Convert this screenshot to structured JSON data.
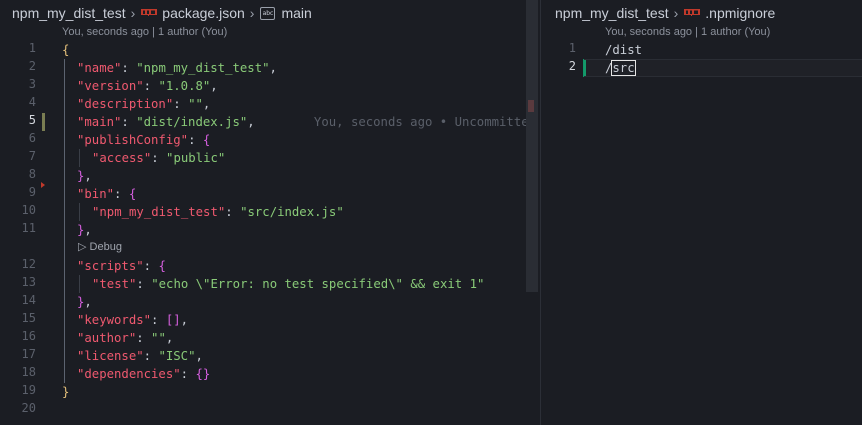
{
  "left": {
    "breadcrumb": {
      "folder": "npm_my_dist_test",
      "file": "package.json",
      "symbol": "main",
      "file_icon": "npm-icon",
      "symbol_icon": "string-symbol-icon"
    },
    "codelens": "You, seconds ago | 1 author (You)",
    "ghost_blame": "You, seconds ago • Uncommitted cha",
    "debug_label": "Debug",
    "line_numbers": [
      "1",
      "2",
      "3",
      "4",
      "5",
      "6",
      "7",
      "8",
      "9",
      "10",
      "11",
      "12",
      "13",
      "14",
      "15",
      "16",
      "17",
      "18",
      "19",
      "20"
    ],
    "lines": [
      {
        "brace": "{"
      },
      {
        "key": "\"name\"",
        "colon": ": ",
        "value": "\"npm_my_dist_test\"",
        "end": ","
      },
      {
        "key": "\"version\"",
        "colon": ": ",
        "value": "\"1.0.8\"",
        "end": ","
      },
      {
        "key": "\"description\"",
        "colon": ": ",
        "value": "\"\"",
        "end": ","
      },
      {
        "key": "\"main\"",
        "colon": ": ",
        "value": "\"dist/index.js\"",
        "end": ","
      },
      {
        "key": "\"publishConfig\"",
        "colon": ": ",
        "open": "{"
      },
      {
        "key": "\"access\"",
        "colon": ": ",
        "value": "\"public\""
      },
      {
        "close": "}",
        "end": ","
      },
      {
        "key": "\"bin\"",
        "colon": ": ",
        "open": "{"
      },
      {
        "key": "\"npm_my_dist_test\"",
        "colon": ": ",
        "value": "\"src/index.js\""
      },
      {
        "close": "}",
        "end": ","
      },
      {
        "key": "\"scripts\"",
        "colon": ": ",
        "open": "{"
      },
      {
        "key": "\"test\"",
        "colon": ": ",
        "value": "\"echo \\\"Error: no test specified\\\" && exit 1\""
      },
      {
        "close": "}",
        "end": ","
      },
      {
        "key": "\"keywords\"",
        "colon": ": ",
        "value": "[]",
        "end": ","
      },
      {
        "key": "\"author\"",
        "colon": ": ",
        "value": "\"\"",
        "end": ","
      },
      {
        "key": "\"license\"",
        "colon": ": ",
        "value": "\"ISC\"",
        "end": ","
      },
      {
        "key": "\"dependencies\"",
        "colon": ": ",
        "value": "{}"
      },
      {
        "brace": "}"
      },
      {}
    ]
  },
  "right": {
    "breadcrumb": {
      "folder": "npm_my_dist_test",
      "file": ".npmignore",
      "file_icon": "npm-icon"
    },
    "codelens": "You, seconds ago | 1 author (You)",
    "line_numbers": [
      "1",
      "2"
    ],
    "lines": [
      "/dist",
      "/src"
    ],
    "line2_prefix": "/",
    "line2_selected": "src"
  },
  "colors": {
    "background": "#1b1d23",
    "key": "#ef596f",
    "string": "#89ca78",
    "brace_outer": "#e5c07b",
    "brace_inner": "#d55fde",
    "modified_gutter": "#7a7d52",
    "added_gutter": "#109868"
  }
}
